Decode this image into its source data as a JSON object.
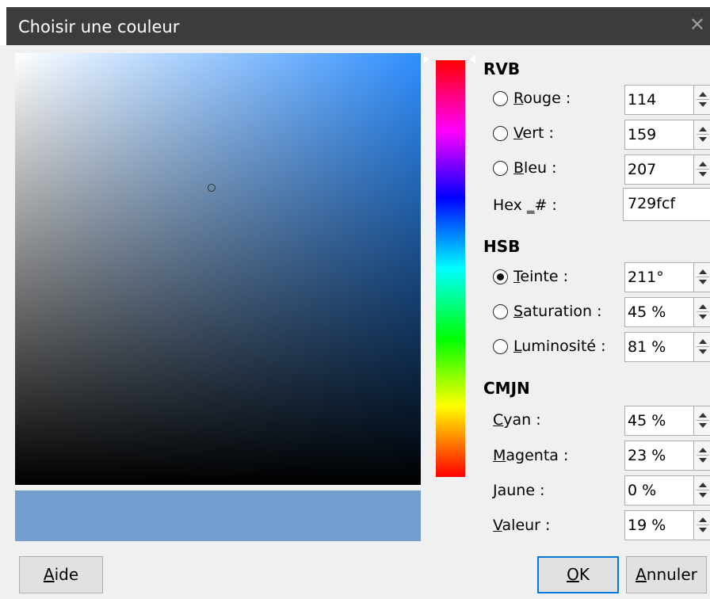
{
  "window": {
    "title": "Choisir une couleur",
    "close_glyph": "✕"
  },
  "color": {
    "current_hex": "#729fcf"
  },
  "rgb": {
    "heading": "RVB",
    "red": {
      "label_u": "R",
      "label_rest": "ouge :",
      "value": "114"
    },
    "green": {
      "label_u": "V",
      "label_rest": "ert :",
      "value": "159"
    },
    "blue": {
      "label_u": "B",
      "label_rest": "leu :",
      "value": "207"
    },
    "hex": {
      "label_pre": "Hex ",
      "label_u": "_",
      "label_rest": "# :",
      "value": "729fcf"
    }
  },
  "hsb": {
    "heading": "HSB",
    "hue": {
      "label_u": "T",
      "label_rest": "einte :",
      "value": "211°",
      "selected": true
    },
    "saturation": {
      "label_u": "S",
      "label_rest": "aturation :",
      "value": "45 %"
    },
    "brightness": {
      "label_u": "L",
      "label_rest": "uminosité :",
      "value": "81 %"
    }
  },
  "cmyk": {
    "heading": "CMJN",
    "cyan": {
      "label_u": "C",
      "label_rest": "yan :",
      "value": "45 %"
    },
    "magenta": {
      "label_u": "M",
      "label_rest": "agenta :",
      "value": "23 %"
    },
    "yellow": {
      "label_u": "J",
      "label_rest": "aune :",
      "value": "0 %"
    },
    "key": {
      "label_u": "V",
      "label_rest": "aleur :",
      "value": "19 %"
    }
  },
  "buttons": {
    "help": {
      "u": "A",
      "rest": "ide"
    },
    "ok": {
      "u": "O",
      "rest": "K"
    },
    "cancel": {
      "u": "A",
      "rest": "nnuler"
    }
  }
}
